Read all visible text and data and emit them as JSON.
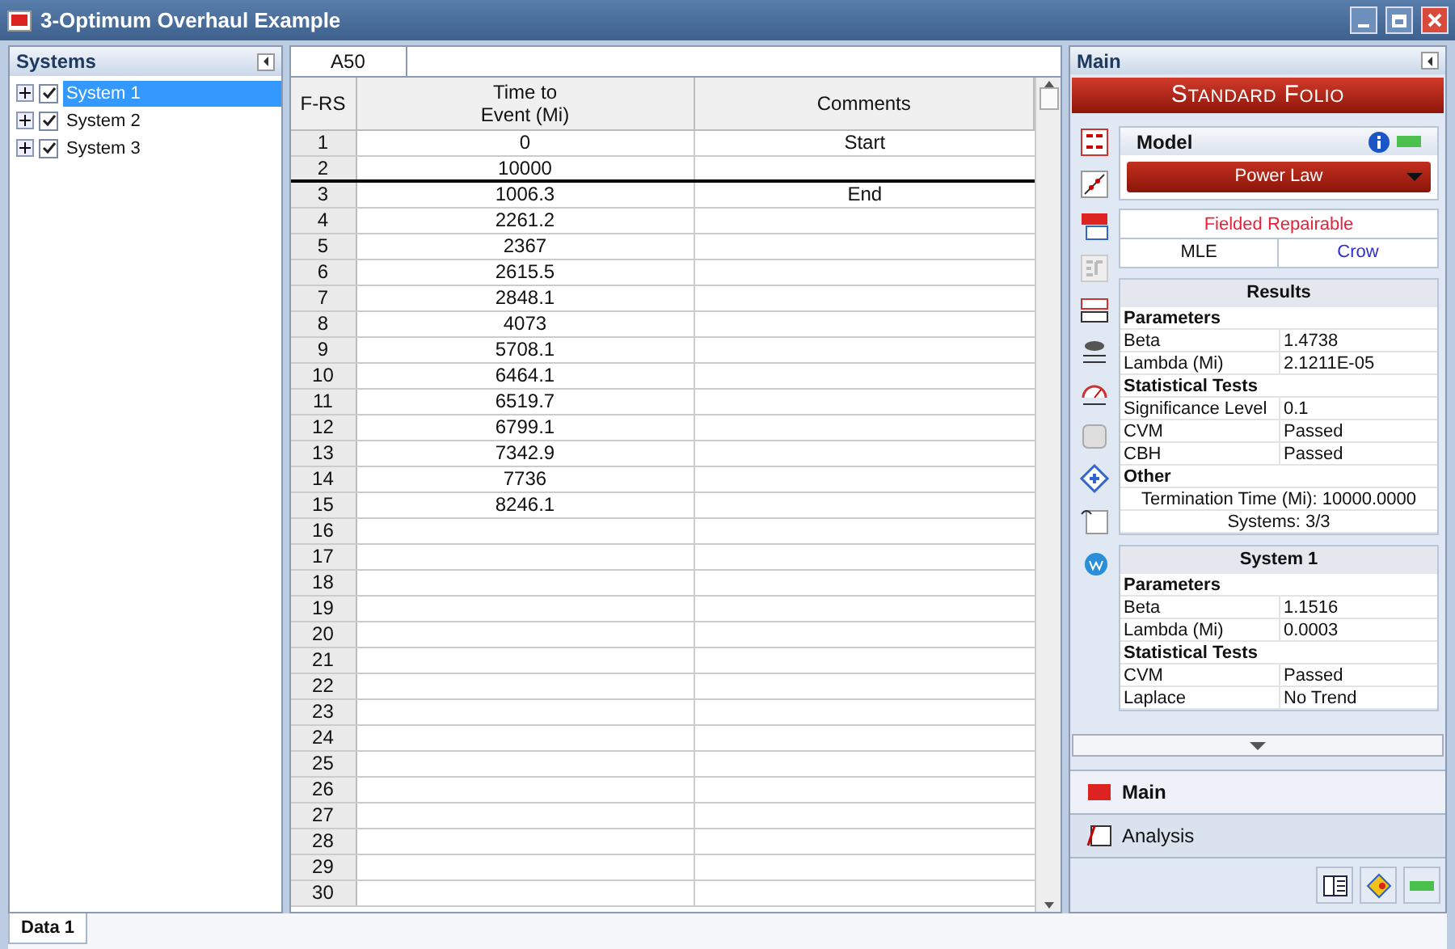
{
  "window": {
    "title": "3-Optimum Overhaul Example"
  },
  "systems_panel": {
    "title": "Systems",
    "items": [
      {
        "label": "System 1",
        "checked": true,
        "selected": true
      },
      {
        "label": "System 2",
        "checked": true,
        "selected": false
      },
      {
        "label": "System 3",
        "checked": true,
        "selected": false
      }
    ]
  },
  "grid": {
    "cell_ref": "A50",
    "columns": [
      "F-RS",
      "Time to\nEvent (Mi)",
      "Comments"
    ],
    "rows": [
      {
        "row": "1",
        "time": "0",
        "comment": "Start",
        "boundary": false
      },
      {
        "row": "2",
        "time": "10000",
        "boundary": true
      },
      {
        "row": "3",
        "time": "1006.3",
        "comment": "End",
        "boundary": false
      },
      {
        "row": "4",
        "time": "2261.2",
        "boundary": false
      },
      {
        "row": "5",
        "time": "2367",
        "boundary": false
      },
      {
        "row": "6",
        "time": "2615.5",
        "boundary": false
      },
      {
        "row": "7",
        "time": "2848.1",
        "boundary": false
      },
      {
        "row": "8",
        "time": "4073",
        "boundary": false
      },
      {
        "row": "9",
        "time": "5708.1",
        "boundary": false
      },
      {
        "row": "10",
        "time": "6464.1",
        "boundary": false
      },
      {
        "row": "11",
        "time": "6519.7",
        "boundary": false
      },
      {
        "row": "12",
        "time": "6799.1",
        "boundary": false
      },
      {
        "row": "13",
        "time": "7342.9",
        "boundary": false
      },
      {
        "row": "14",
        "time": "7736",
        "boundary": false
      },
      {
        "row": "15",
        "time": "8246.1",
        "boundary": false
      },
      {
        "row": "16",
        "boundary": false
      },
      {
        "row": "17",
        "boundary": false
      },
      {
        "row": "18",
        "boundary": false
      },
      {
        "row": "19",
        "boundary": false
      },
      {
        "row": "20",
        "boundary": false
      },
      {
        "row": "21",
        "boundary": false
      },
      {
        "row": "22",
        "boundary": false
      },
      {
        "row": "23",
        "boundary": false
      },
      {
        "row": "24",
        "boundary": false
      },
      {
        "row": "25",
        "boundary": false
      },
      {
        "row": "26",
        "boundary": false
      },
      {
        "row": "27",
        "boundary": false
      },
      {
        "row": "28",
        "boundary": false
      },
      {
        "row": "29",
        "boundary": false
      },
      {
        "row": "30",
        "boundary": false
      }
    ]
  },
  "folio": {
    "title": "Main",
    "banner": "Standard Folio",
    "model": {
      "title": "Model",
      "value": "Power Law"
    },
    "data_type": "Fielded Repairable",
    "method": "MLE",
    "method_detail": "Crow",
    "results": {
      "title": "Results",
      "rows": [
        {
          "kind": "heading",
          "text": "Parameters"
        },
        {
          "kind": "pair",
          "label": "Beta",
          "value": "1.4738"
        },
        {
          "kind": "pair",
          "label": "Lambda (Mi)",
          "value": "2.1211E-05"
        },
        {
          "kind": "heading",
          "text": "Statistical Tests"
        },
        {
          "kind": "pair",
          "label": "Significance Level",
          "value": "0.1"
        },
        {
          "kind": "pair",
          "label": "CVM",
          "value": "Passed"
        },
        {
          "kind": "pair",
          "label": "CBH",
          "value": "Passed"
        },
        {
          "kind": "heading",
          "text": "Other"
        },
        {
          "kind": "line",
          "text": "Termination Time (Mi): 10000.0000"
        },
        {
          "kind": "line",
          "text": "Systems: 3/3"
        }
      ]
    },
    "system": {
      "title": "System 1",
      "rows": [
        {
          "kind": "heading",
          "text": "Parameters"
        },
        {
          "kind": "pair",
          "label": "Beta",
          "value": "1.1516"
        },
        {
          "kind": "pair",
          "label": "Lambda (Mi)",
          "value": "0.0003"
        },
        {
          "kind": "heading",
          "text": "Statistical Tests"
        },
        {
          "kind": "pair",
          "label": "CVM",
          "value": "Passed"
        },
        {
          "kind": "pair",
          "label": "Laplace",
          "value": "No Trend"
        }
      ]
    }
  },
  "nav": [
    {
      "label": "Main",
      "selected": true
    },
    {
      "label": "Analysis",
      "selected": false
    }
  ],
  "sheet_tabs": [
    {
      "label": "Data 1",
      "selected": true
    }
  ]
}
